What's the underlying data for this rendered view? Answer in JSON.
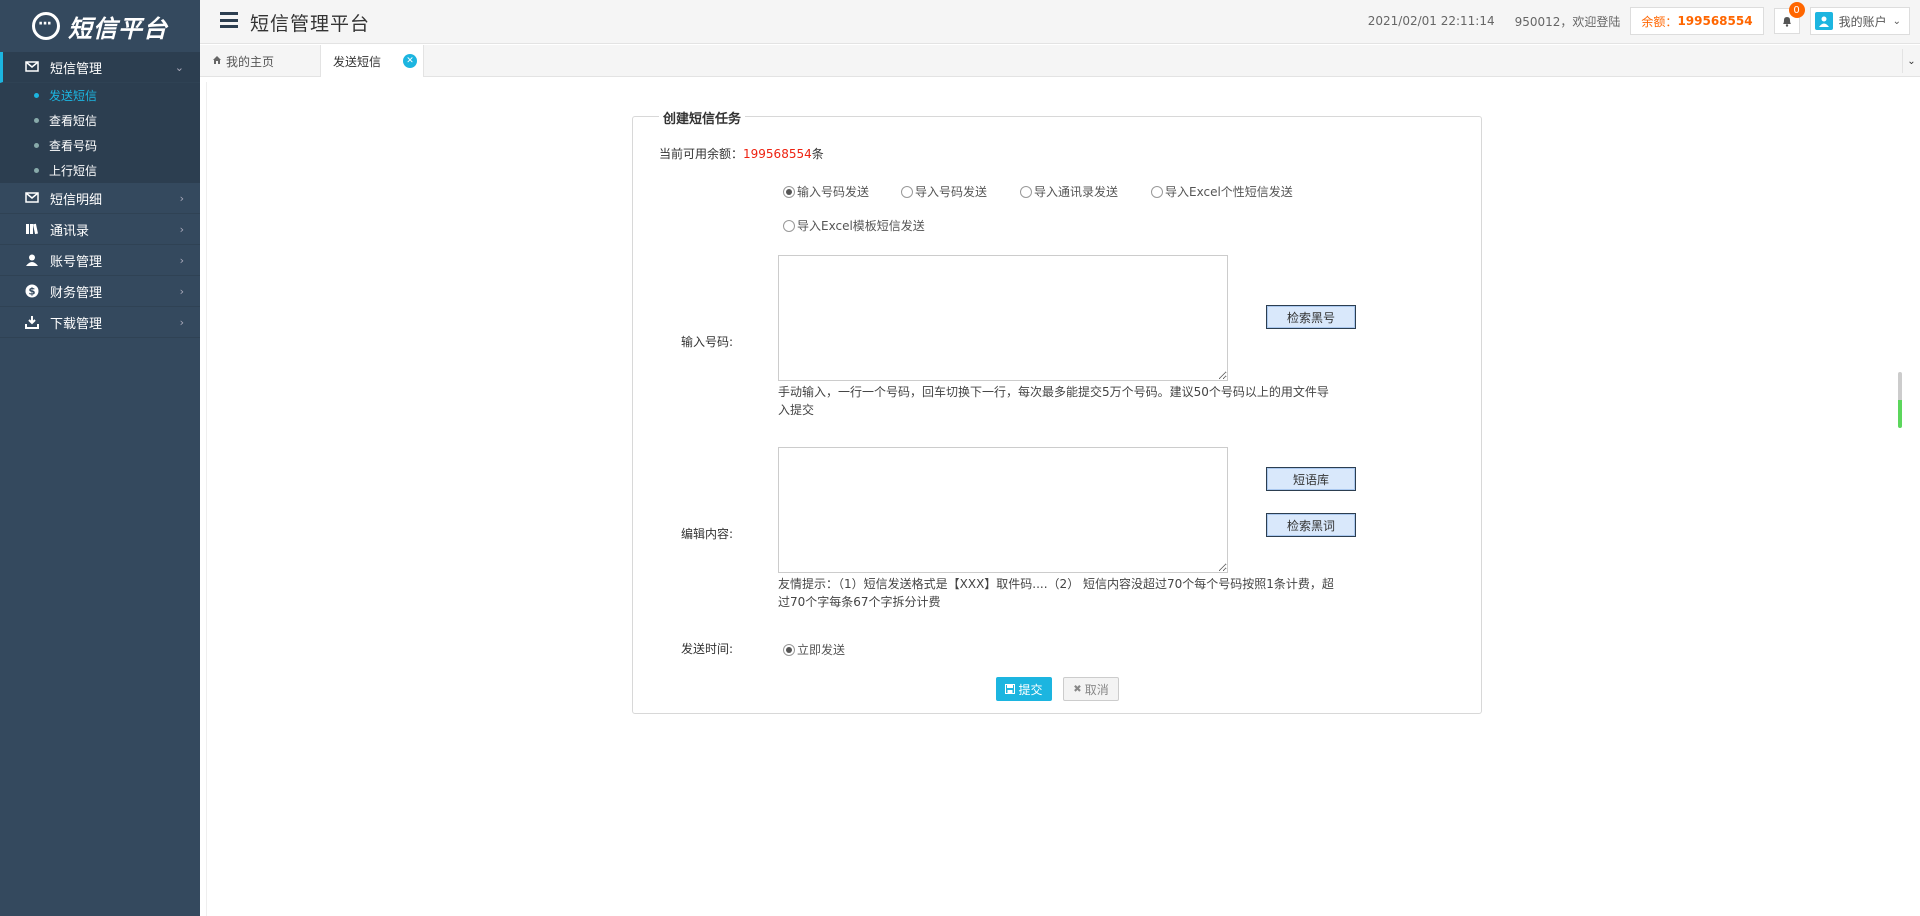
{
  "brand": {
    "name": "短信平台"
  },
  "sidebar": {
    "groups": [
      {
        "label": "短信管理",
        "icon": "sms-icon",
        "items": [
          "发送短信",
          "查看短信",
          "查看号码",
          "上行短信"
        ]
      },
      {
        "label": "短信明细",
        "icon": "sms-detail-icon"
      },
      {
        "label": "通讯录",
        "icon": "contacts-icon"
      },
      {
        "label": "账号管理",
        "icon": "user-icon"
      },
      {
        "label": "财务管理",
        "icon": "dollar-icon"
      },
      {
        "label": "下载管理",
        "icon": "download-icon"
      }
    ]
  },
  "header": {
    "title": "短信管理平台",
    "datetime": "2021/02/01 22:11:14",
    "welcome": "950012，欢迎登陆",
    "balance_label": "余额：",
    "balance_value": "199568554",
    "notification_count": "0",
    "account_label": "我的账户"
  },
  "tabs": {
    "home": "我的主页",
    "active": "发送短信"
  },
  "form": {
    "legend": "创建短信任务",
    "balance_prefix": "当前可用余额：",
    "balance_value": "199568554",
    "balance_unit": "条",
    "send_modes": [
      "输入号码发送",
      "导入号码发送",
      "导入通讯录发送",
      "导入Excel个性短信发送",
      "导入Excel模板短信发送"
    ],
    "numbers_label": "输入号码:",
    "numbers_value": "",
    "check_blacklist_number": "检索黑号",
    "numbers_hint": "手动输入，一行一个号码，回车切换下一行，每次最多能提交5万个号码。建议50个号码以上的用文件导入提交",
    "content_label": "编辑内容:",
    "content_value": "",
    "phrase_library": "短语库",
    "check_blacklist_word": "检索黑词",
    "content_hint": "友情提示：（1）短信发送格式是【XXX】取件码....（2） 短信内容没超过70个每个号码按照1条计费，超过70个字每条67个字拆分计费",
    "send_time_label": "发送时间:",
    "send_time_option": "立即发送",
    "submit": "提交",
    "cancel": "取消"
  },
  "colors": {
    "sidebar_bg": "#34495e",
    "accent": "#1cb5e0",
    "balance": "#ff6600",
    "balance_red": "#ee2211"
  }
}
